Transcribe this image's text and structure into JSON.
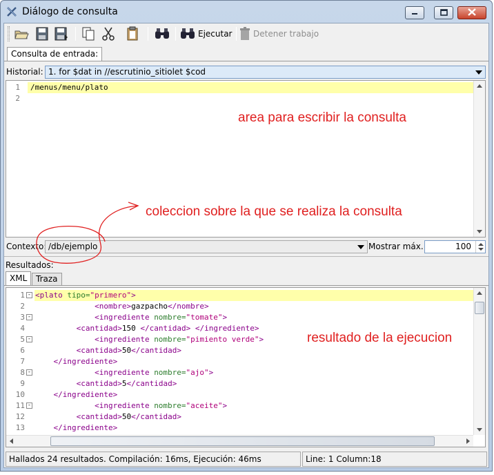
{
  "window": {
    "title": "Diálogo de consulta"
  },
  "toolbar": {
    "run_label": "Ejecutar",
    "stop_label": "Detener trabajo"
  },
  "input_tab": {
    "label": "Consulta de entrada:"
  },
  "history": {
    "label": "Historial:",
    "value": "1. for $dat in //escrutinio_sitiolet $cod"
  },
  "query_editor": {
    "line_numbers": [
      "1",
      "2"
    ],
    "lines": [
      "/menus/menu/plato",
      ""
    ]
  },
  "context": {
    "label": "Contexto:",
    "value": "/db/ejemplo"
  },
  "max_results": {
    "label": "Mostrar máx.:",
    "value": "100"
  },
  "results": {
    "label": "Resultados:",
    "tabs": [
      "XML",
      "Traza"
    ],
    "line_numbers": [
      "1",
      "2",
      "3",
      "4",
      "5",
      "6",
      "7",
      "8",
      "9",
      "10",
      "11",
      "12",
      "13"
    ]
  },
  "status": {
    "left": "Hallados 24 resultados. Compilación: 16ms, Ejecución: 46ms",
    "right": "Line: 1 Column:18"
  },
  "annotations": {
    "query_area": "area para escribir la consulta",
    "collection": "coleccion sobre la que se realiza la consulta",
    "result": "resultado de la ejecucion"
  },
  "colors": {
    "annotation": "#e02020",
    "tag": "#8a008a",
    "attribute": "#2e7d2e",
    "attr_value": "#b0007a",
    "current_line": "#ffffaa"
  }
}
